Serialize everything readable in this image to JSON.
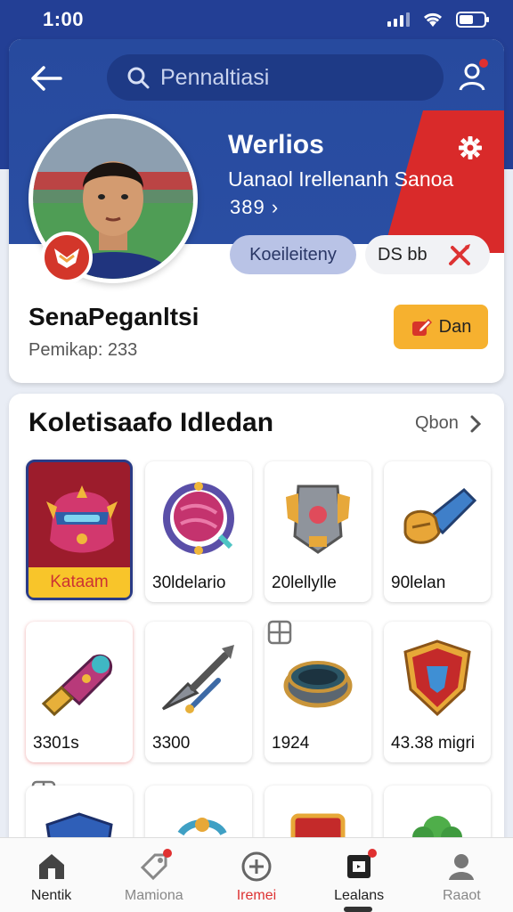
{
  "status_bar": {
    "time": "1:00"
  },
  "header": {
    "search_placeholder": "Pennaltiasi"
  },
  "profile": {
    "title": "Werlios",
    "subtitle": "Uanaol Irellenanh Sanoa",
    "count": "389 ›",
    "pill_primary": "Koeileiteny",
    "pill_secondary": "DS bb",
    "name": "SenaPeganltsi",
    "sub": "Pemikap: 233",
    "action_label": "Dan"
  },
  "collection": {
    "title": "Koletisaafo Idledan",
    "see_all": "Qbon",
    "items": [
      {
        "label": "Kataam",
        "icon": "helmet-icon"
      },
      {
        "label": "30ldelario",
        "icon": "orb-icon"
      },
      {
        "label": "20lellylle",
        "icon": "armor-icon"
      },
      {
        "label": "90lelan",
        "icon": "gauntlet-icon"
      },
      {
        "label": "3301s",
        "icon": "blaster-icon"
      },
      {
        "label": "3300",
        "icon": "spear-icon"
      },
      {
        "label": "1924",
        "icon": "ring-icon"
      },
      {
        "label": "43.38 migri",
        "icon": "shield-icon"
      }
    ]
  },
  "bottom_nav": [
    {
      "label": "Nentik",
      "icon": "home-icon"
    },
    {
      "label": "Mamiona",
      "icon": "tag-icon"
    },
    {
      "label": "Iremei",
      "icon": "plus-circle-icon"
    },
    {
      "label": "Lealans",
      "icon": "document-icon"
    },
    {
      "label": "Raaot",
      "icon": "profile-icon"
    }
  ],
  "colors": {
    "brand_blue": "#233f95",
    "accent_red": "#d92a2a",
    "accent_yellow": "#f6b12f"
  }
}
